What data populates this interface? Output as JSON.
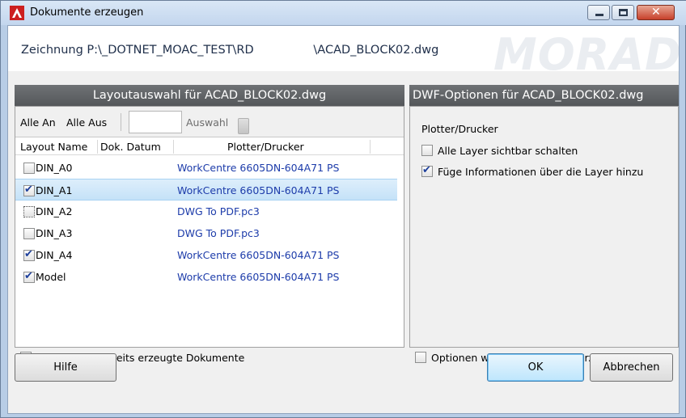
{
  "window": {
    "title": "Dokumente erzeugen",
    "drawing_path": "Zeichnung P:\\_DOTNET_MOAC_TEST\\RD                \\ACAD_BLOCK02.dwg",
    "watermark": "MORADA"
  },
  "left_panel": {
    "header": "Layoutauswahl für ACAD_BLOCK02.dwg",
    "toolbar": {
      "alle_an": "Alle An",
      "alle_aus": "Alle Aus",
      "search_value": "",
      "auswahl_label": "Auswahl"
    },
    "columns": [
      "Layout Name",
      "Dok. Datum",
      "Plotter/Drucker"
    ],
    "rows": [
      {
        "name": "DIN_A0",
        "date": "",
        "plotter": "WorkCentre 6605DN-604A71 PS",
        "state": "unchecked"
      },
      {
        "name": "DIN_A1",
        "date": "",
        "plotter": "WorkCentre 6605DN-604A71 PS",
        "state": "checked"
      },
      {
        "name": "DIN_A2",
        "date": "",
        "plotter": "DWG To PDF.pc3",
        "state": "indeterminate"
      },
      {
        "name": "DIN_A3",
        "date": "",
        "plotter": "DWG To PDF.pc3",
        "state": "unchecked"
      },
      {
        "name": "DIN_A4",
        "date": "",
        "plotter": "WorkCentre 6605DN-604A71 PS",
        "state": "checked"
      },
      {
        "name": "Model",
        "date": "",
        "plotter": "WorkCentre 6605DN-604A71 PS",
        "state": "checked"
      }
    ],
    "selected_row": "DIN_A1",
    "bottom_option": {
      "label": "Layouts wie bereits erzeugte Dokumente",
      "checked": false
    }
  },
  "right_panel": {
    "header": "DWF-Optionen für ACAD_BLOCK02.dwg",
    "plotter_label": "Plotter/Drucker",
    "options": [
      {
        "label": "Alle Layer sichtbar schalten",
        "checked": false
      },
      {
        "label": "Füge Informationen über die Layer hinzu",
        "checked": true
      }
    ],
    "bottom_option": {
      "label": "Optionen wie bei der letzten Erzeugung",
      "checked": false
    }
  },
  "buttons": {
    "help": "Hilfe",
    "ok": "OK",
    "cancel": "Abbrechen"
  },
  "colors": {
    "panel_header": "#5f6265",
    "plotter_text": "#1d3caa",
    "selected_row": "#cfe7fa",
    "close_button": "#c7402b",
    "app_icon": "#cc1f1f"
  }
}
